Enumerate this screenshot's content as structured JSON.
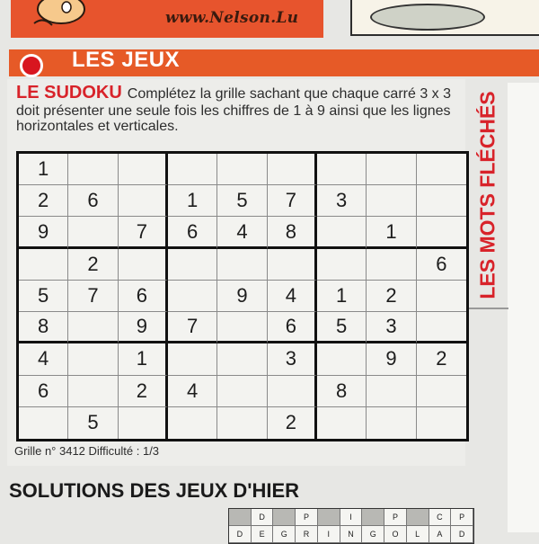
{
  "masthead": {
    "url": "www.Nelson.Lu"
  },
  "section": {
    "title": "LES JEUX"
  },
  "sudoku": {
    "kicker": "LE SUDOKU",
    "instructions": "Complétez la grille sachant que chaque carré 3 x 3 doit présenter une seule fois les chiffres de 1 à 9 ainsi que les lignes horizontales et verticales.",
    "footer": "Grille n° 3412  Difficulté : 1/3",
    "grid": [
      [
        "1",
        "",
        "",
        "",
        "",
        "",
        "",
        "",
        ""
      ],
      [
        "2",
        "6",
        "",
        "1",
        "5",
        "7",
        "3",
        "",
        ""
      ],
      [
        "9",
        "",
        "7",
        "6",
        "4",
        "8",
        "",
        "1",
        ""
      ],
      [
        "",
        "2",
        "",
        "",
        "",
        "",
        "",
        "",
        "6"
      ],
      [
        "5",
        "7",
        "6",
        "",
        "9",
        "4",
        "1",
        "2",
        ""
      ],
      [
        "8",
        "",
        "9",
        "7",
        "",
        "6",
        "5",
        "3",
        ""
      ],
      [
        "4",
        "",
        "1",
        "",
        "",
        "3",
        "",
        "9",
        "2"
      ],
      [
        "6",
        "",
        "2",
        "4",
        "",
        "",
        "8",
        "",
        ""
      ],
      [
        "",
        "5",
        "",
        "",
        "",
        "2",
        "",
        "",
        ""
      ]
    ]
  },
  "sidebar": {
    "label": "LES MOTS FLÉCHÉS"
  },
  "solutions": {
    "title": "SOLUTIONS DES JEUX D'HIER",
    "rows": [
      [
        "",
        "D",
        "",
        "P",
        "",
        "I",
        "",
        "P",
        "",
        "C",
        "P"
      ],
      [
        "D",
        "E",
        "G",
        "R",
        "I",
        "N",
        "G",
        "O",
        "L",
        "A",
        "D"
      ]
    ]
  }
}
